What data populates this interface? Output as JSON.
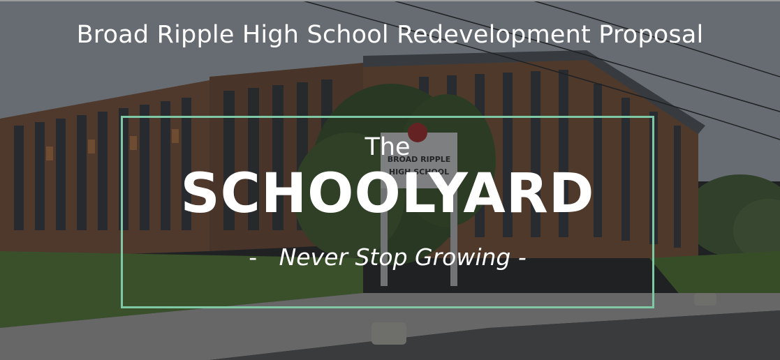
{
  "header": {
    "title": "Broad Ripple High School Redevelopment Proposal"
  },
  "hero": {
    "pre_title": "The",
    "title": "SCHOOLYARD",
    "tagline_lead": "-",
    "tagline": "Never Stop Growing",
    "tagline_trail": "-"
  },
  "sign": {
    "line1": "BROAD RIPPLE",
    "line2": "HIGH SCHOOL"
  },
  "colors": {
    "frame_border": "#7ec8a5",
    "text": "#ffffff",
    "overlay": "#141618"
  }
}
